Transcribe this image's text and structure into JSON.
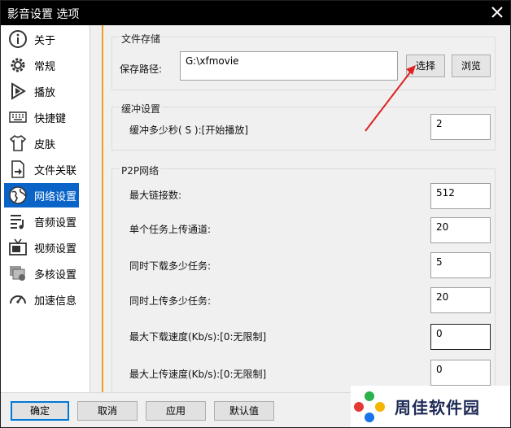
{
  "window": {
    "title": "影音设置 选项"
  },
  "sidebar": {
    "items": [
      {
        "label": "关于",
        "icon": "info-icon"
      },
      {
        "label": "常规",
        "icon": "gear-icon"
      },
      {
        "label": "播放",
        "icon": "play-icon"
      },
      {
        "label": "快捷键",
        "icon": "keyboard-icon"
      },
      {
        "label": "皮肤",
        "icon": "shirt-icon"
      },
      {
        "label": "文件关联",
        "icon": "file-link-icon"
      },
      {
        "label": "网络设置",
        "icon": "globe-icon",
        "active": true
      },
      {
        "label": "音频设置",
        "icon": "music-list-icon"
      },
      {
        "label": "视频设置",
        "icon": "tv-icon"
      },
      {
        "label": "多核设置",
        "icon": "multicore-icon"
      },
      {
        "label": "加速信息",
        "icon": "gauge-icon"
      }
    ]
  },
  "storage": {
    "title": "文件存储",
    "path_label": "保存路径:",
    "path_value": "G:\\xfmovie",
    "select_label": "选择",
    "browse_label": "浏览"
  },
  "buffer": {
    "title": "缓冲设置",
    "label": "缓冲多少秒( S ):[开始播放]",
    "value": "2"
  },
  "p2p": {
    "title": "P2P网络",
    "rows": [
      {
        "label": "最大链接数:",
        "value": "512"
      },
      {
        "label": "单个任务上传通道:",
        "value": "20"
      },
      {
        "label": "同时下载多少任务:",
        "value": "5"
      },
      {
        "label": "同时上传多少任务:",
        "value": "20"
      },
      {
        "label": "最大下载速度(Kb/s):[0:无限制]",
        "value": "0"
      },
      {
        "label": "最大上传速度(Kb/s):[0:无限制]",
        "value": "0"
      }
    ]
  },
  "footer": {
    "ok": "确定",
    "cancel": "取消",
    "apply": "应用",
    "default": "默认值"
  },
  "watermark": {
    "text": "周佳软件园"
  },
  "colors": {
    "accent": "#0a64c8",
    "divider": "#f0a020",
    "annotation": "#e02020"
  }
}
